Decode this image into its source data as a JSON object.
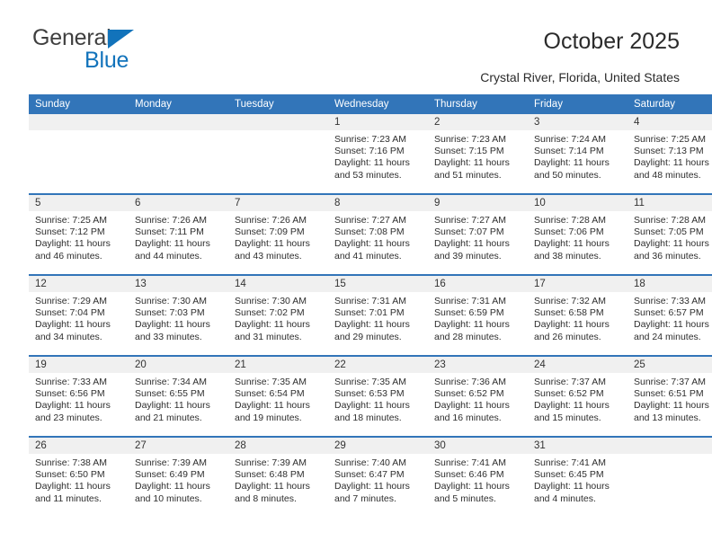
{
  "brand": {
    "name_part1": "General",
    "name_part2": "Blue",
    "triangle_color": "#1273bb"
  },
  "header": {
    "title": "October 2025",
    "subtitle": "Crystal River, Florida, United States",
    "header_bg_color": "#3275b9",
    "daynum_bg_color": "#f0f0f0"
  },
  "weekday_headers": [
    "Sunday",
    "Monday",
    "Tuesday",
    "Wednesday",
    "Thursday",
    "Friday",
    "Saturday"
  ],
  "labels": {
    "sunrise_prefix": "Sunrise:",
    "sunset_prefix": "Sunset:",
    "daylight_prefix": "Daylight:"
  },
  "weeks": [
    [
      {
        "day": "",
        "empty": true
      },
      {
        "day": "",
        "empty": true
      },
      {
        "day": "",
        "empty": true
      },
      {
        "day": "1",
        "sunrise": "Sunrise: 7:23 AM",
        "sunset": "Sunset: 7:16 PM",
        "daylight": "Daylight: 11 hours and 53 minutes."
      },
      {
        "day": "2",
        "sunrise": "Sunrise: 7:23 AM",
        "sunset": "Sunset: 7:15 PM",
        "daylight": "Daylight: 11 hours and 51 minutes."
      },
      {
        "day": "3",
        "sunrise": "Sunrise: 7:24 AM",
        "sunset": "Sunset: 7:14 PM",
        "daylight": "Daylight: 11 hours and 50 minutes."
      },
      {
        "day": "4",
        "sunrise": "Sunrise: 7:25 AM",
        "sunset": "Sunset: 7:13 PM",
        "daylight": "Daylight: 11 hours and 48 minutes."
      }
    ],
    [
      {
        "day": "5",
        "sunrise": "Sunrise: 7:25 AM",
        "sunset": "Sunset: 7:12 PM",
        "daylight": "Daylight: 11 hours and 46 minutes."
      },
      {
        "day": "6",
        "sunrise": "Sunrise: 7:26 AM",
        "sunset": "Sunset: 7:11 PM",
        "daylight": "Daylight: 11 hours and 44 minutes."
      },
      {
        "day": "7",
        "sunrise": "Sunrise: 7:26 AM",
        "sunset": "Sunset: 7:09 PM",
        "daylight": "Daylight: 11 hours and 43 minutes."
      },
      {
        "day": "8",
        "sunrise": "Sunrise: 7:27 AM",
        "sunset": "Sunset: 7:08 PM",
        "daylight": "Daylight: 11 hours and 41 minutes."
      },
      {
        "day": "9",
        "sunrise": "Sunrise: 7:27 AM",
        "sunset": "Sunset: 7:07 PM",
        "daylight": "Daylight: 11 hours and 39 minutes."
      },
      {
        "day": "10",
        "sunrise": "Sunrise: 7:28 AM",
        "sunset": "Sunset: 7:06 PM",
        "daylight": "Daylight: 11 hours and 38 minutes."
      },
      {
        "day": "11",
        "sunrise": "Sunrise: 7:28 AM",
        "sunset": "Sunset: 7:05 PM",
        "daylight": "Daylight: 11 hours and 36 minutes."
      }
    ],
    [
      {
        "day": "12",
        "sunrise": "Sunrise: 7:29 AM",
        "sunset": "Sunset: 7:04 PM",
        "daylight": "Daylight: 11 hours and 34 minutes."
      },
      {
        "day": "13",
        "sunrise": "Sunrise: 7:30 AM",
        "sunset": "Sunset: 7:03 PM",
        "daylight": "Daylight: 11 hours and 33 minutes."
      },
      {
        "day": "14",
        "sunrise": "Sunrise: 7:30 AM",
        "sunset": "Sunset: 7:02 PM",
        "daylight": "Daylight: 11 hours and 31 minutes."
      },
      {
        "day": "15",
        "sunrise": "Sunrise: 7:31 AM",
        "sunset": "Sunset: 7:01 PM",
        "daylight": "Daylight: 11 hours and 29 minutes."
      },
      {
        "day": "16",
        "sunrise": "Sunrise: 7:31 AM",
        "sunset": "Sunset: 6:59 PM",
        "daylight": "Daylight: 11 hours and 28 minutes."
      },
      {
        "day": "17",
        "sunrise": "Sunrise: 7:32 AM",
        "sunset": "Sunset: 6:58 PM",
        "daylight": "Daylight: 11 hours and 26 minutes."
      },
      {
        "day": "18",
        "sunrise": "Sunrise: 7:33 AM",
        "sunset": "Sunset: 6:57 PM",
        "daylight": "Daylight: 11 hours and 24 minutes."
      }
    ],
    [
      {
        "day": "19",
        "sunrise": "Sunrise: 7:33 AM",
        "sunset": "Sunset: 6:56 PM",
        "daylight": "Daylight: 11 hours and 23 minutes."
      },
      {
        "day": "20",
        "sunrise": "Sunrise: 7:34 AM",
        "sunset": "Sunset: 6:55 PM",
        "daylight": "Daylight: 11 hours and 21 minutes."
      },
      {
        "day": "21",
        "sunrise": "Sunrise: 7:35 AM",
        "sunset": "Sunset: 6:54 PM",
        "daylight": "Daylight: 11 hours and 19 minutes."
      },
      {
        "day": "22",
        "sunrise": "Sunrise: 7:35 AM",
        "sunset": "Sunset: 6:53 PM",
        "daylight": "Daylight: 11 hours and 18 minutes."
      },
      {
        "day": "23",
        "sunrise": "Sunrise: 7:36 AM",
        "sunset": "Sunset: 6:52 PM",
        "daylight": "Daylight: 11 hours and 16 minutes."
      },
      {
        "day": "24",
        "sunrise": "Sunrise: 7:37 AM",
        "sunset": "Sunset: 6:52 PM",
        "daylight": "Daylight: 11 hours and 15 minutes."
      },
      {
        "day": "25",
        "sunrise": "Sunrise: 7:37 AM",
        "sunset": "Sunset: 6:51 PM",
        "daylight": "Daylight: 11 hours and 13 minutes."
      }
    ],
    [
      {
        "day": "26",
        "sunrise": "Sunrise: 7:38 AM",
        "sunset": "Sunset: 6:50 PM",
        "daylight": "Daylight: 11 hours and 11 minutes."
      },
      {
        "day": "27",
        "sunrise": "Sunrise: 7:39 AM",
        "sunset": "Sunset: 6:49 PM",
        "daylight": "Daylight: 11 hours and 10 minutes."
      },
      {
        "day": "28",
        "sunrise": "Sunrise: 7:39 AM",
        "sunset": "Sunset: 6:48 PM",
        "daylight": "Daylight: 11 hours and 8 minutes."
      },
      {
        "day": "29",
        "sunrise": "Sunrise: 7:40 AM",
        "sunset": "Sunset: 6:47 PM",
        "daylight": "Daylight: 11 hours and 7 minutes."
      },
      {
        "day": "30",
        "sunrise": "Sunrise: 7:41 AM",
        "sunset": "Sunset: 6:46 PM",
        "daylight": "Daylight: 11 hours and 5 minutes."
      },
      {
        "day": "31",
        "sunrise": "Sunrise: 7:41 AM",
        "sunset": "Sunset: 6:45 PM",
        "daylight": "Daylight: 11 hours and 4 minutes."
      },
      {
        "day": "",
        "empty": true
      }
    ]
  ]
}
